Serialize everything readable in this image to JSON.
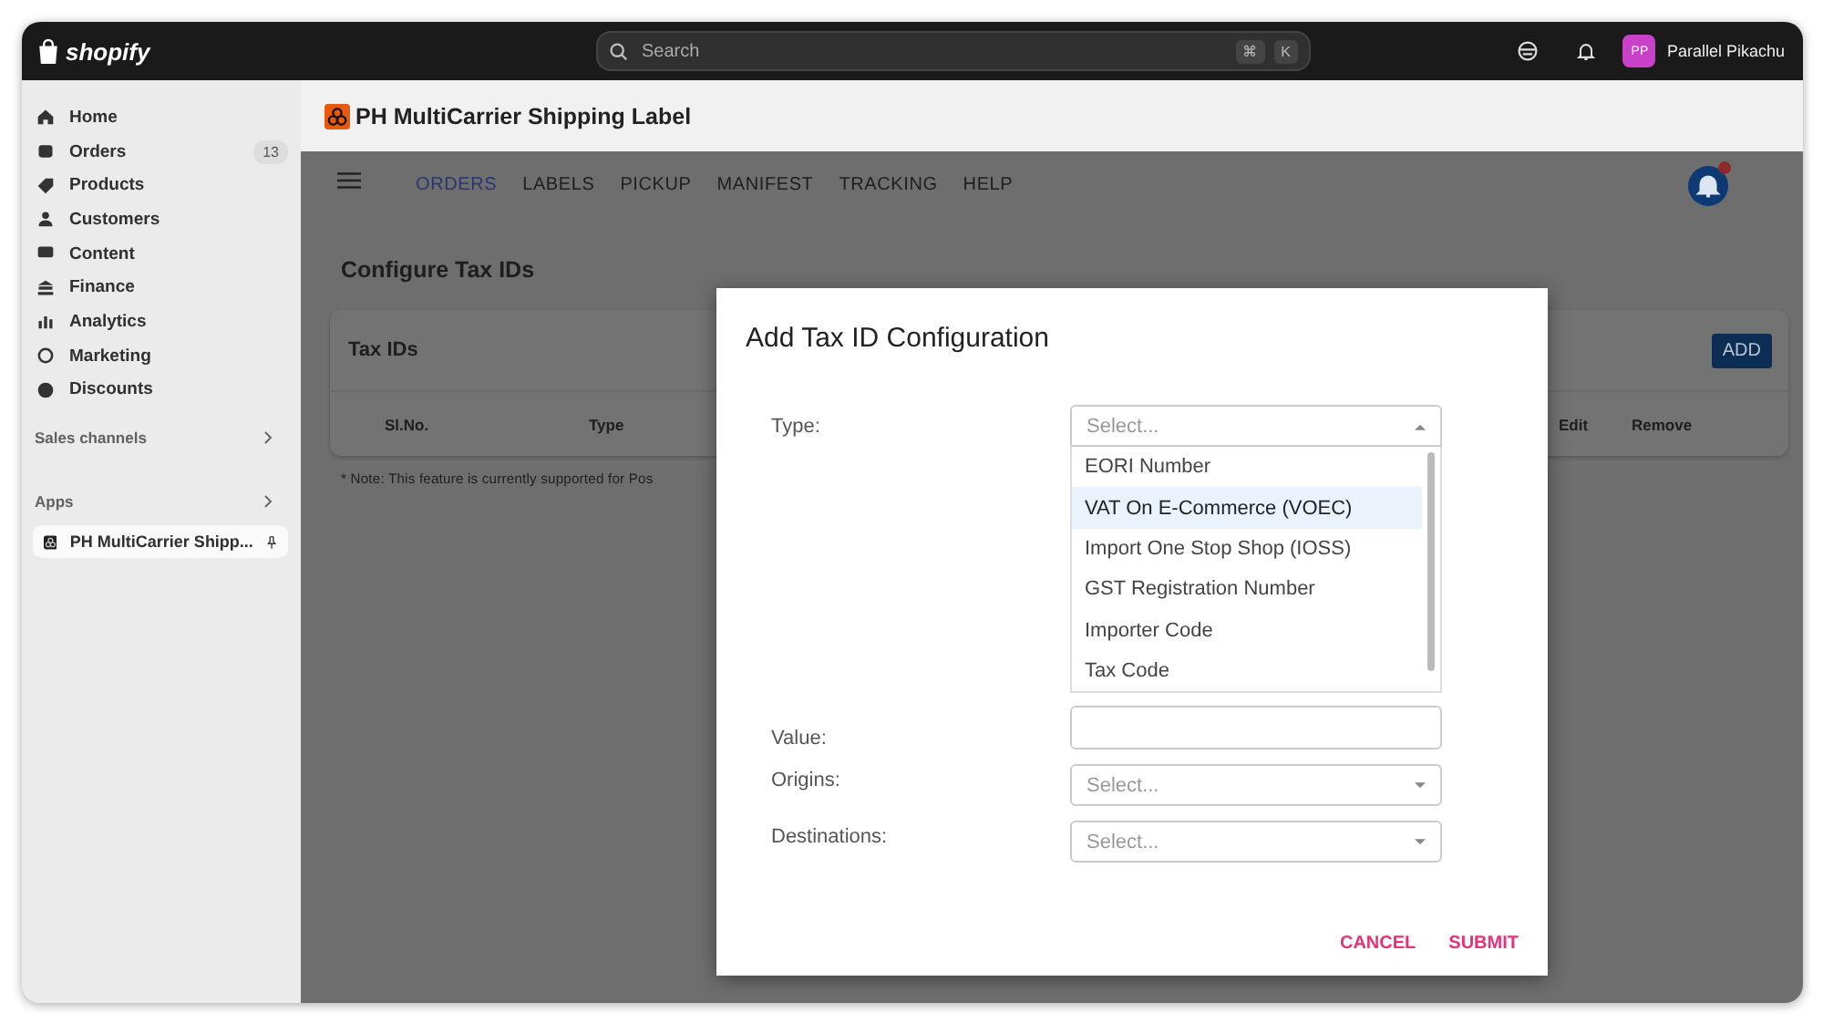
{
  "topbar": {
    "logo": "shopify",
    "search": {
      "placeholder": "Search"
    },
    "shortcut_keys": [
      "⌘",
      "K"
    ],
    "avatar": "PP",
    "user": "Parallel Pikachu"
  },
  "sidebar": {
    "items": [
      {
        "label": "Home"
      },
      {
        "label": "Orders",
        "badge": "13"
      },
      {
        "label": "Products"
      },
      {
        "label": "Customers"
      },
      {
        "label": "Content"
      },
      {
        "label": "Finance"
      },
      {
        "label": "Analytics"
      },
      {
        "label": "Marketing"
      },
      {
        "label": "Discounts"
      }
    ],
    "sections": [
      "Sales channels",
      "Apps"
    ],
    "apps": [
      {
        "label": "PH MultiCarrier Shipp...",
        "selected": true
      }
    ]
  },
  "app_header": {
    "title": "PH MultiCarrier Shipping Label"
  },
  "nav": {
    "tabs": [
      {
        "label": "ORDERS",
        "selected": true
      },
      {
        "label": "LABELS",
        "selected": false
      },
      {
        "label": "PICKUP",
        "selected": false
      },
      {
        "label": "MANIFEST",
        "selected": false
      },
      {
        "label": "TRACKING",
        "selected": false
      },
      {
        "label": "HELP",
        "selected": false
      }
    ]
  },
  "page": {
    "title": "Configure Tax IDs",
    "card_title": "Tax IDs",
    "add_button": "ADD",
    "columns": [
      "Sl.No.",
      "Type",
      "Edit",
      "Remove"
    ],
    "note": "* Note: This feature is currently supported for Pos"
  },
  "modal": {
    "title": "Add Tax ID Configuration",
    "fields": [
      {
        "label": "Type:",
        "kind": "select",
        "placeholder": "Select...",
        "expanded": true,
        "options": [
          {
            "label": "EORI Number",
            "highlighted": false
          },
          {
            "label": "VAT On E-Commerce (VOEC)",
            "highlighted": true
          },
          {
            "label": "Import One Stop Shop (IOSS)",
            "highlighted": false
          },
          {
            "label": "GST Registration Number",
            "highlighted": false
          },
          {
            "label": "Importer Code",
            "highlighted": false
          },
          {
            "label": "Tax Code",
            "highlighted": false
          }
        ]
      },
      {
        "label": "Value:",
        "kind": "text"
      },
      {
        "label": "Origins:",
        "kind": "select",
        "placeholder": "Select...",
        "expanded": false
      },
      {
        "label": "Destinations:",
        "kind": "select",
        "placeholder": "Select...",
        "expanded": false
      }
    ],
    "buttons": [
      "CANCEL",
      "SUBMIT"
    ]
  }
}
